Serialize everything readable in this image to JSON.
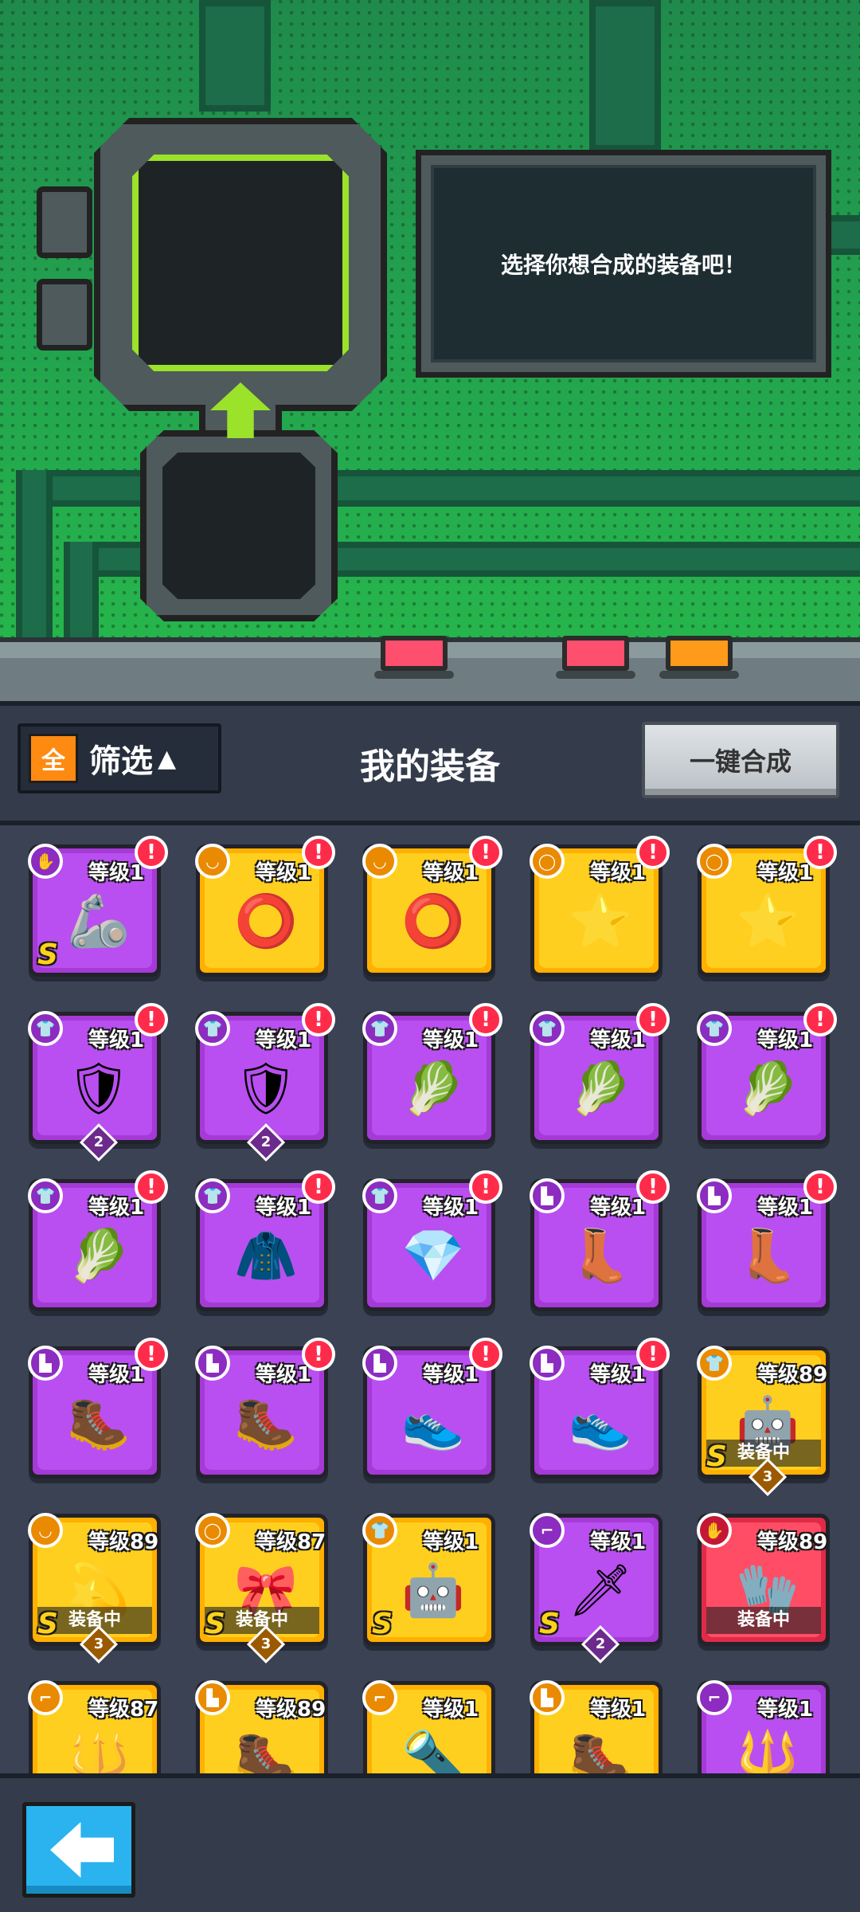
{
  "machine": {
    "message": "选择你想合成的装备吧！"
  },
  "header": {
    "filter_badge": "全",
    "filter_label": "筛选",
    "filter_arrow": "▲",
    "title": "我的装备",
    "oneclick_label": "一键合成"
  },
  "colors": {
    "accent_green": "#9be22a",
    "purple_card": "#b94ff0",
    "gold_card": "#ffcf1f",
    "red_card": "#ff4d65",
    "back_button": "#2ab3ee"
  },
  "items": [
    {
      "rarity": "purple",
      "slot": "glove-icon",
      "level": "等级1",
      "alert": "!",
      "art": "🦾",
      "rank": "S"
    },
    {
      "rarity": "gold",
      "slot": "necklace-icon",
      "level": "等级1",
      "alert": "!",
      "art": "⭕"
    },
    {
      "rarity": "gold",
      "slot": "necklace-icon",
      "level": "等级1",
      "alert": "!",
      "art": "⭕"
    },
    {
      "rarity": "gold",
      "slot": "belt-icon",
      "level": "等级1",
      "alert": "!",
      "art": "⭐"
    },
    {
      "rarity": "gold",
      "slot": "belt-icon",
      "level": "等级1",
      "alert": "!",
      "art": "⭐"
    },
    {
      "rarity": "purple",
      "slot": "armor-icon",
      "level": "等级1",
      "alert": "!",
      "art": "🛡",
      "count": "2"
    },
    {
      "rarity": "purple",
      "slot": "armor-icon",
      "level": "等级1",
      "alert": "!",
      "art": "🛡",
      "count": "2"
    },
    {
      "rarity": "purple",
      "slot": "armor-icon",
      "level": "等级1",
      "alert": "!",
      "art": "🥬"
    },
    {
      "rarity": "purple",
      "slot": "armor-icon",
      "level": "等级1",
      "alert": "!",
      "art": "🥬"
    },
    {
      "rarity": "purple",
      "slot": "armor-icon",
      "level": "等级1",
      "alert": "!",
      "art": "🥬"
    },
    {
      "rarity": "purple",
      "slot": "armor-icon",
      "level": "等级1",
      "alert": "!",
      "art": "🥬"
    },
    {
      "rarity": "purple",
      "slot": "armor-icon",
      "level": "等级1",
      "alert": "!",
      "art": "🧥"
    },
    {
      "rarity": "purple",
      "slot": "armor-icon",
      "level": "等级1",
      "alert": "!",
      "art": "💎"
    },
    {
      "rarity": "purple",
      "slot": "boots-icon",
      "level": "等级1",
      "alert": "!",
      "art": "👢"
    },
    {
      "rarity": "purple",
      "slot": "boots-icon",
      "level": "等级1",
      "alert": "!",
      "art": "👢"
    },
    {
      "rarity": "purple",
      "slot": "boots-icon",
      "level": "等级1",
      "alert": "!",
      "art": "🥾"
    },
    {
      "rarity": "purple",
      "slot": "boots-icon",
      "level": "等级1",
      "alert": "!",
      "art": "🥾"
    },
    {
      "rarity": "purple",
      "slot": "boots-icon",
      "level": "等级1",
      "alert": "!",
      "art": "👟"
    },
    {
      "rarity": "purple",
      "slot": "boots-icon",
      "level": "等级1",
      "alert": "!",
      "art": "👟"
    },
    {
      "rarity": "gold",
      "slot": "armor-icon",
      "level": "等级89",
      "art": "🤖",
      "rank": "S",
      "equipped": "装备中",
      "count": "3"
    },
    {
      "rarity": "gold",
      "slot": "necklace-icon",
      "level": "等级89",
      "art": "💫",
      "rank": "S",
      "equipped": "装备中",
      "count": "3"
    },
    {
      "rarity": "gold",
      "slot": "belt-icon",
      "level": "等级87",
      "art": "🎀",
      "rank": "S",
      "equipped": "装备中",
      "count": "3"
    },
    {
      "rarity": "gold",
      "slot": "armor-icon",
      "level": "等级1",
      "art": "🤖",
      "rank": "S"
    },
    {
      "rarity": "purple",
      "slot": "gun-icon",
      "level": "等级1",
      "art": "🗡",
      "rank": "S",
      "count": "2"
    },
    {
      "rarity": "red",
      "slot": "glove-icon",
      "level": "等级89",
      "art": "🧤",
      "equipped": "装备中"
    },
    {
      "rarity": "gold",
      "slot": "gun-icon",
      "level": "等级87",
      "art": "🔱"
    },
    {
      "rarity": "gold",
      "slot": "boots-icon",
      "level": "等级89",
      "art": "🥾"
    },
    {
      "rarity": "gold",
      "slot": "gun-icon",
      "level": "等级1",
      "art": "🔦"
    },
    {
      "rarity": "gold",
      "slot": "boots-icon",
      "level": "等级1",
      "art": "🥾"
    },
    {
      "rarity": "purple",
      "slot": "gun-icon",
      "level": "等级1",
      "art": "🔱"
    }
  ],
  "slot_glyphs": {
    "glove-icon": "✋",
    "necklace-icon": "◡",
    "belt-icon": "◯",
    "armor-icon": "👕",
    "boots-icon": "▙",
    "gun-icon": "⌐"
  }
}
